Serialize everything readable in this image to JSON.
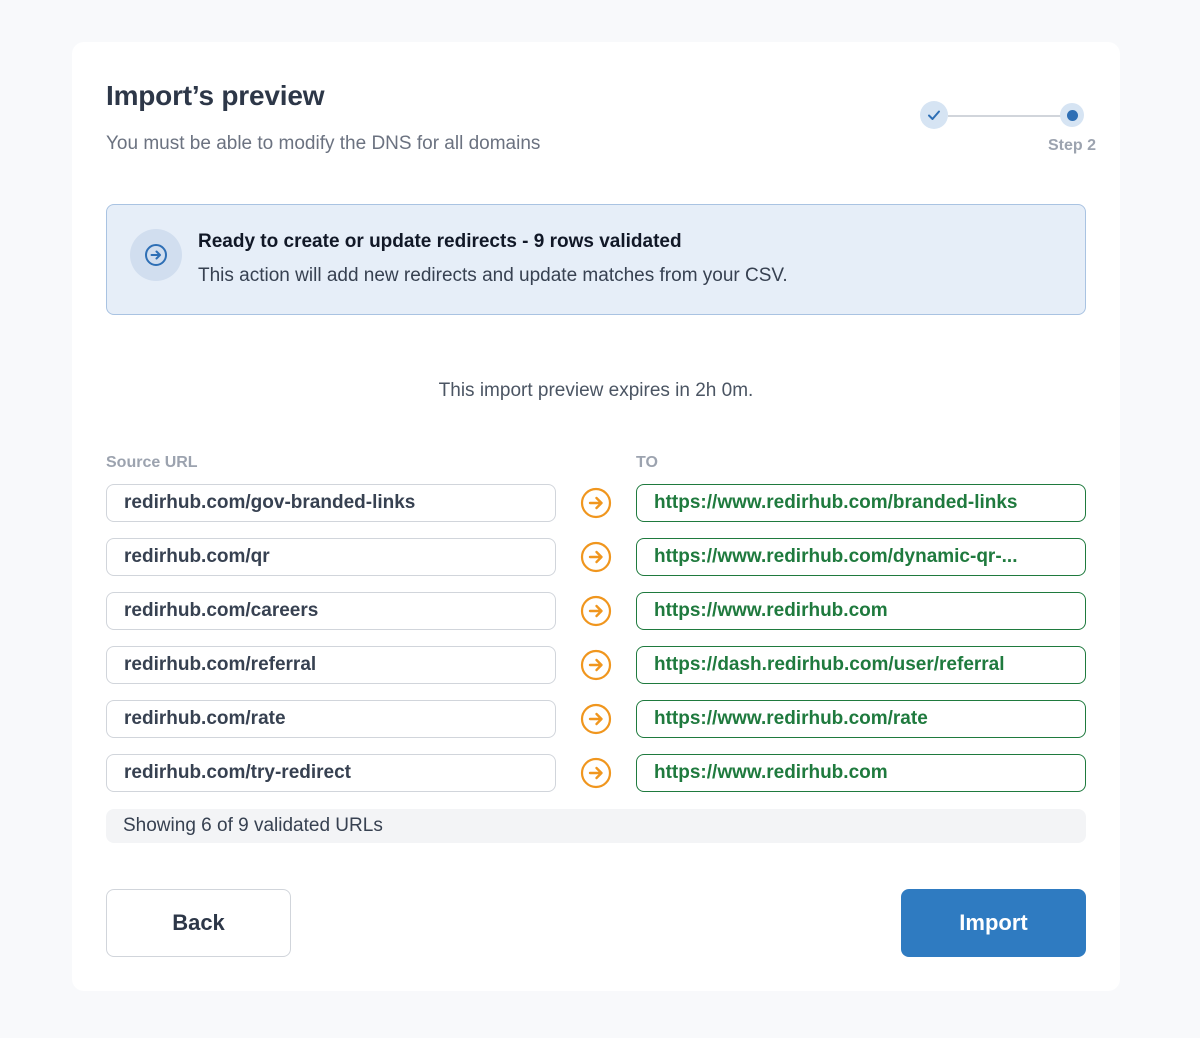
{
  "header": {
    "title": "Import’s preview",
    "subtitle": "You must be able to modify the DNS for all domains"
  },
  "stepper": {
    "current_label": "Step 2"
  },
  "banner": {
    "title": "Ready to create or update redirects - 9 rows validated",
    "description": "This action will add new redirects and update matches from your CSV."
  },
  "expiry_text": "This import preview expires in 2h 0m.",
  "columns": {
    "source": "Source URL",
    "to": "TO"
  },
  "rows": [
    {
      "source": "redirhub.com/gov-branded-links",
      "to": "https://www.redirhub.com/branded-links"
    },
    {
      "source": "redirhub.com/qr",
      "to": "https://www.redirhub.com/dynamic-qr-..."
    },
    {
      "source": "redirhub.com/careers",
      "to": "https://www.redirhub.com"
    },
    {
      "source": "redirhub.com/referral",
      "to": "https://dash.redirhub.com/user/referral"
    },
    {
      "source": "redirhub.com/rate",
      "to": "https://www.redirhub.com/rate"
    },
    {
      "source": "redirhub.com/try-redirect",
      "to": "https://www.redirhub.com"
    }
  ],
  "showing_text": "Showing 6 of 9 validated URLs",
  "buttons": {
    "back": "Back",
    "import": "Import"
  },
  "colors": {
    "accent": "#2f7bc1",
    "success": "#1f7a3e",
    "arrow": "#f0961e",
    "banner_bg": "#e6eef8"
  },
  "icons": {
    "step_done": "check-icon",
    "banner": "arrow-right-circle-icon",
    "row_arrow": "arrow-right-circle-icon"
  }
}
